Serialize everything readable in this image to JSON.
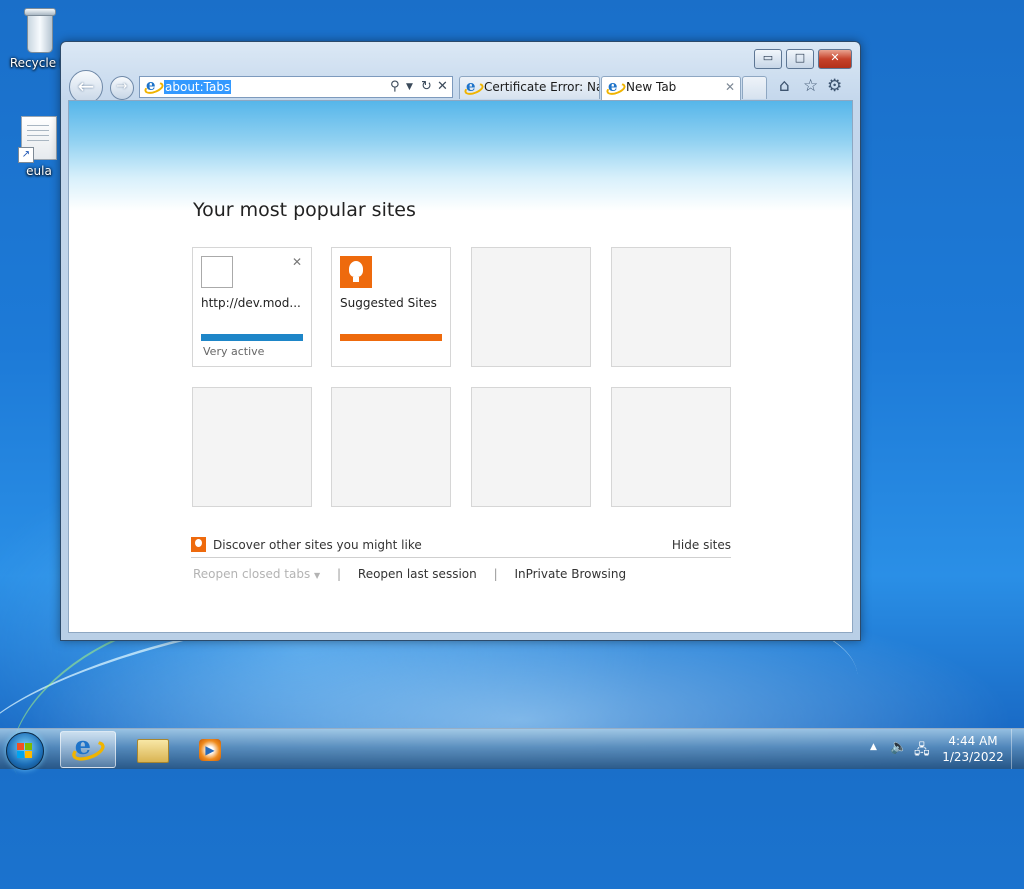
{
  "desktop": {
    "icons": [
      {
        "label": "Recycle B"
      },
      {
        "label": "eula"
      }
    ]
  },
  "browser": {
    "address": "about:Tabs",
    "tabs": [
      {
        "label": "Certificate Error: Na..."
      },
      {
        "label": "New Tab"
      }
    ],
    "window_controls": {
      "minimize": "▭",
      "maximize": "□",
      "close": "✕"
    }
  },
  "newtab": {
    "heading": "Your most popular sites",
    "tiles": [
      {
        "label": "http://dev.mod...",
        "status": "Very active",
        "bar_color": "#1e86c8"
      },
      {
        "label": "Suggested Sites",
        "status": "",
        "bar_color": "#ee6a0d"
      }
    ],
    "discover_text": "Discover other sites you might like",
    "hide_sites": "Hide sites",
    "links": {
      "reopen_closed": "Reopen closed tabs",
      "reopen_last": "Reopen last session",
      "inprivate": "InPrivate Browsing"
    }
  },
  "taskbar": {
    "clock_time": "4:44 AM",
    "clock_date": "1/23/2022"
  },
  "colors": {
    "accent_blue": "#1e86c8",
    "accent_orange": "#ee6a0d",
    "desktop_blue": "#1d7ad7"
  }
}
